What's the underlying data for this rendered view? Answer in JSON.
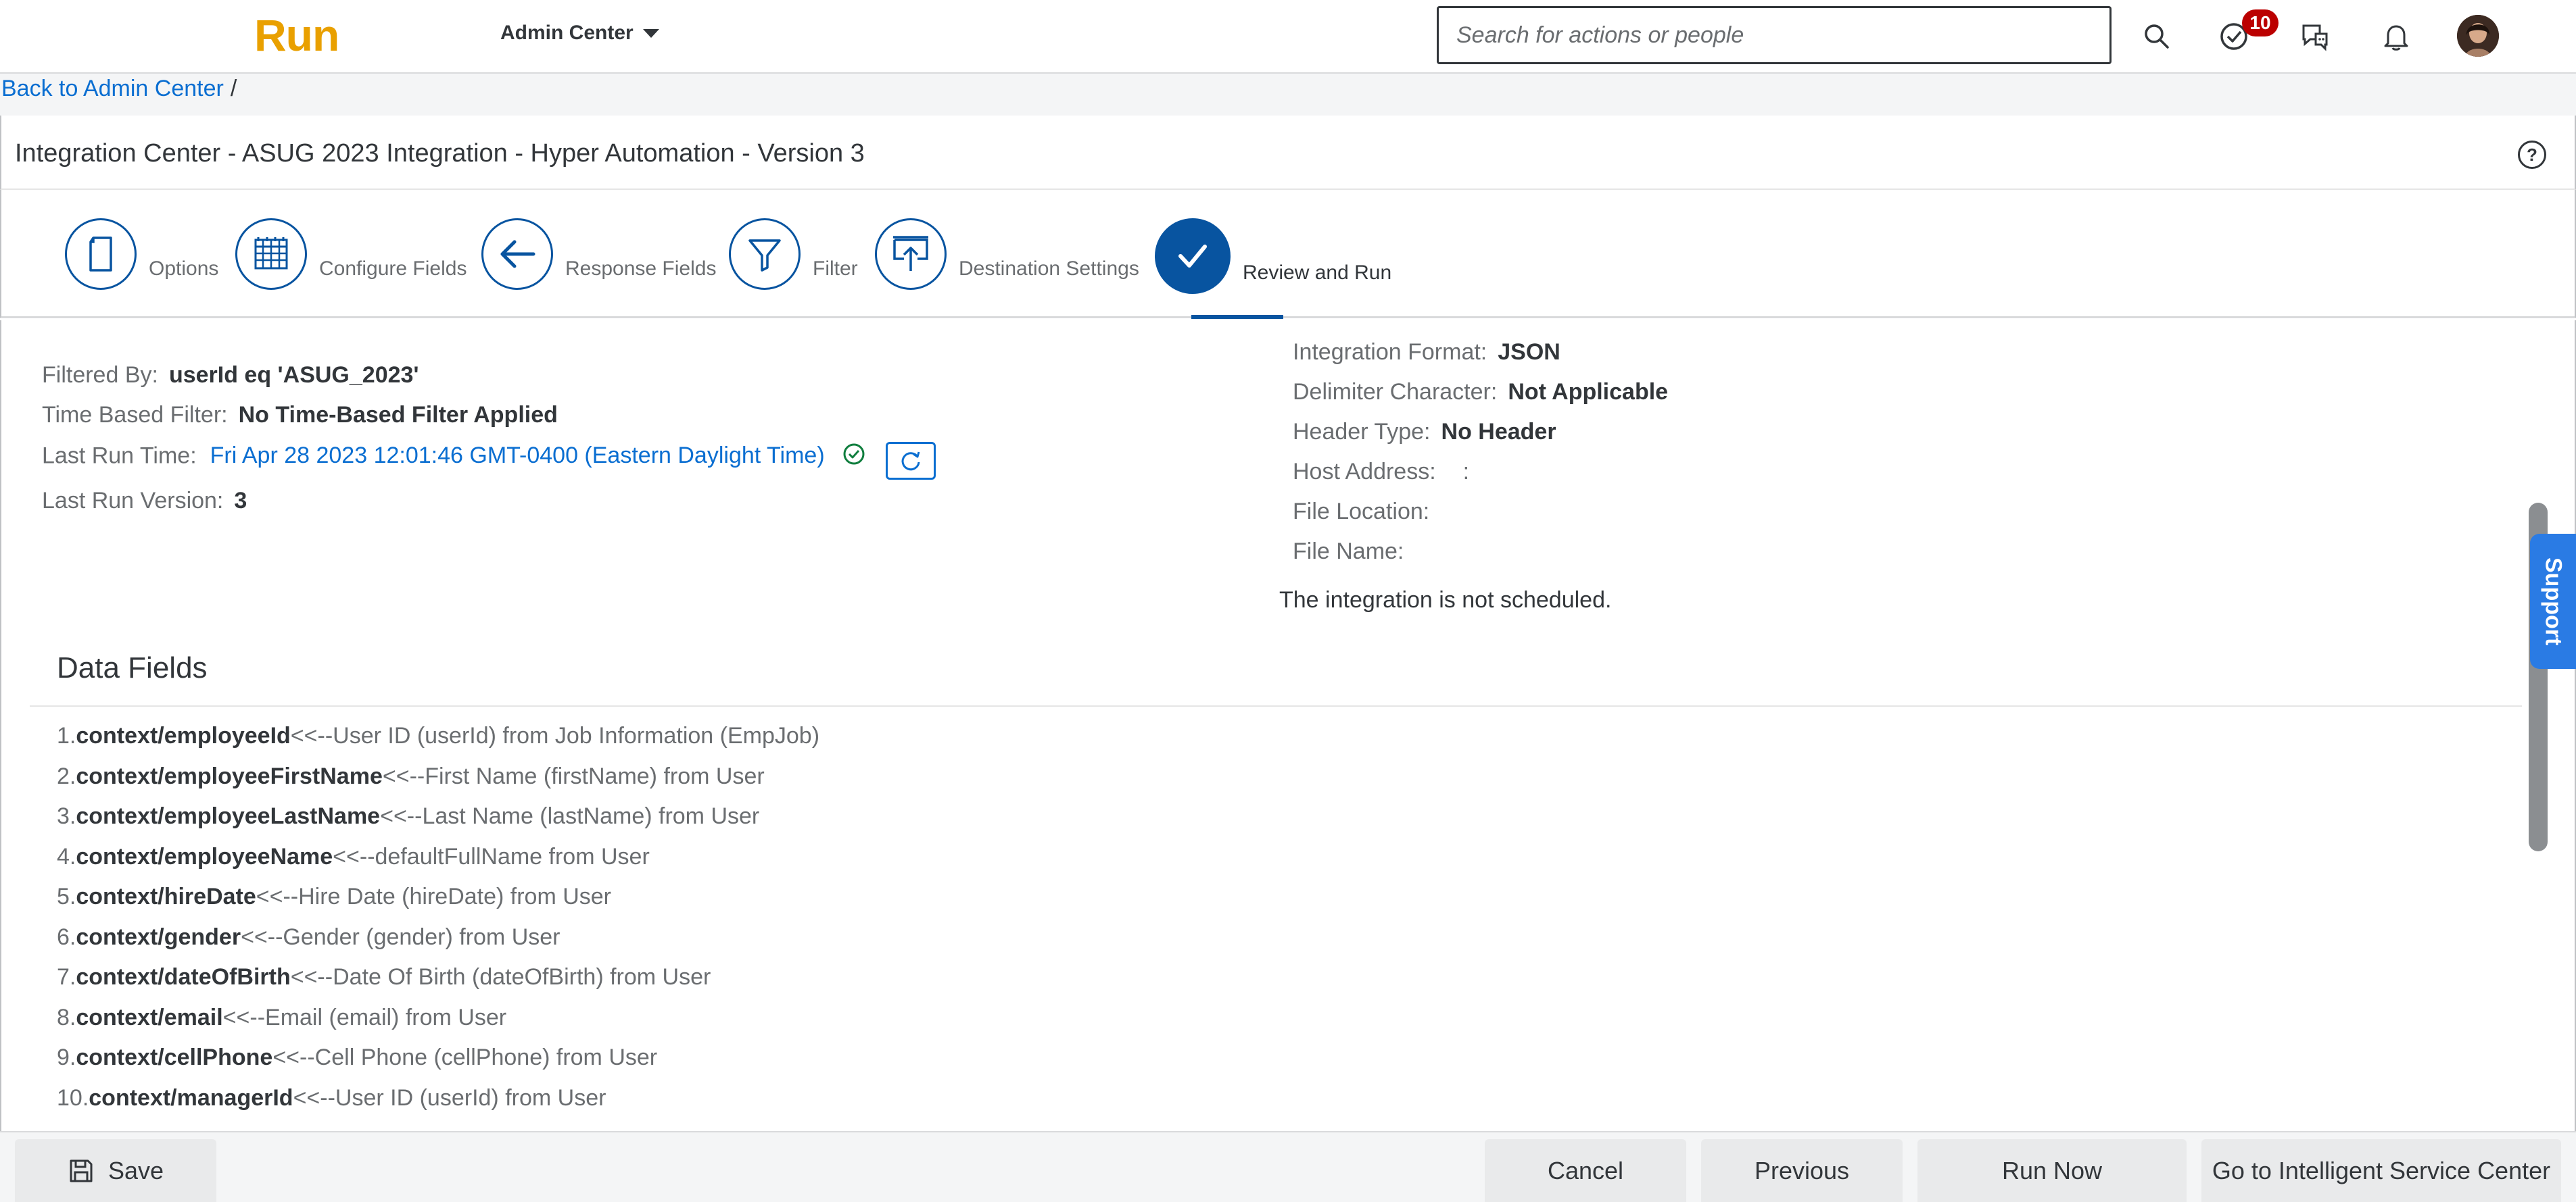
{
  "shell": {
    "logo": "Run",
    "product_menu": "Admin Center",
    "search_placeholder": "Search for actions or people",
    "notification_badge": "10",
    "icons": [
      "search-icon",
      "todo-check-icon",
      "feedback-icon",
      "bell-icon",
      "avatar"
    ]
  },
  "breadcrumb": {
    "back": "Back to Admin Center",
    "separator": "/"
  },
  "page": {
    "title": "Integration Center - ASUG 2023 Integration - Hyper Automation - Version 3",
    "help": "?"
  },
  "wizard": {
    "steps": [
      {
        "label": "Options",
        "icon": "document-icon"
      },
      {
        "label": "Configure Fields",
        "icon": "grid-icon"
      },
      {
        "label": "Response Fields",
        "icon": "arrow-left-icon"
      },
      {
        "label": "Filter",
        "icon": "filter-icon"
      },
      {
        "label": "Destination Settings",
        "icon": "upload-icon"
      },
      {
        "label": "Review and Run",
        "icon": "check-icon",
        "active": true
      }
    ]
  },
  "summary_left": {
    "filtered_by_label": "Filtered By:",
    "filtered_by_value": "userId eq 'ASUG_2023'",
    "time_filter_label": "Time Based Filter:",
    "time_filter_value": "No Time-Based Filter Applied",
    "last_run_label": "Last Run Time:",
    "last_run_value": "Fri Apr 28 2023 12:01:46 GMT-0400 (Eastern Daylight Time)",
    "last_version_label": "Last Run Version:",
    "last_version_value": "3"
  },
  "summary_right": {
    "format_label": "Integration Format:",
    "format_value": "JSON",
    "delimiter_label": "Delimiter Character:",
    "delimiter_value": "Not Applicable",
    "header_label": "Header Type:",
    "header_value": "No Header",
    "host_label": "Host Address:",
    "host_value": ":",
    "file_location_label": "File Location:",
    "file_name_label": "File Name:",
    "schedule_note": "The integration is not scheduled."
  },
  "data_fields": {
    "title": "Data Fields",
    "items": [
      {
        "num": "1.",
        "field": "context/employeeId",
        "desc": "<<--User ID (userId) from Job Information (EmpJob)"
      },
      {
        "num": "2.",
        "field": "context/employeeFirstName",
        "desc": "<<--First Name (firstName) from User"
      },
      {
        "num": "3.",
        "field": "context/employeeLastName",
        "desc": "<<--Last Name (lastName) from User"
      },
      {
        "num": "4.",
        "field": "context/employeeName",
        "desc": "<<--defaultFullName from User"
      },
      {
        "num": "5.",
        "field": "context/hireDate",
        "desc": "<<--Hire Date (hireDate) from User"
      },
      {
        "num": "6.",
        "field": "context/gender",
        "desc": "<<--Gender (gender) from User"
      },
      {
        "num": "7.",
        "field": "context/dateOfBirth",
        "desc": "<<--Date Of Birth (dateOfBirth) from User"
      },
      {
        "num": "8.",
        "field": "context/email",
        "desc": "<<--Email (email) from User"
      },
      {
        "num": "9.",
        "field": "context/cellPhone",
        "desc": "<<--Cell Phone (cellPhone) from User"
      },
      {
        "num": "10.",
        "field": "context/managerId",
        "desc": "<<--User ID (userId) from User"
      }
    ]
  },
  "support_tab": "Support",
  "footer": {
    "save": "Save",
    "cancel": "Cancel",
    "previous": "Previous",
    "run_now": "Run Now",
    "go_isc": "Go to Intelligent Service Center"
  },
  "colors": {
    "brand": "#e9a000",
    "accent": "#0854a0",
    "link": "#0a6ed1",
    "badge": "#bb0000",
    "support": "#2a7be4",
    "success": "#107e3e"
  }
}
